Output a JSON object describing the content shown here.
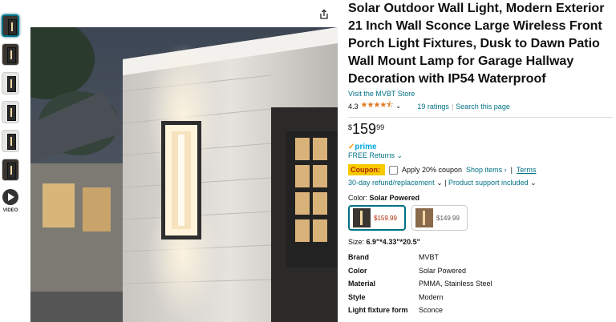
{
  "thumbnails": {
    "video_label": "VIDEO"
  },
  "product": {
    "title": "Solar Outdoor Wall Light, Modern Exterior 21 Inch Wall Sconce Large Wireless Front Porch Light Fixtures, Dusk to Dawn Patio Wall Mount Lamp for Garage Hallway Decoration with IP54 Waterproof",
    "store_link": "Visit the MVBT Store",
    "rating": "4.3",
    "rating_stars": 4.3,
    "ratings_count": "19 ratings",
    "search_page": "Search this page",
    "price_currency": "$",
    "price_whole": "159",
    "price_fraction": "99",
    "prime": "prime",
    "free_returns": "FREE Returns",
    "coupon_badge": "Coupon:",
    "coupon_text": "Apply 20% coupon",
    "shop_items": "Shop items ›",
    "terms": "Terms",
    "refund": "30-day refund/replacement",
    "support": "Product support included",
    "color_label": "Color:",
    "color_value": "Solar Powered",
    "swatches": [
      {
        "price": "$159.99"
      },
      {
        "price": "$149.99"
      }
    ],
    "size_label": "Size:",
    "size_value": "6.9\"*4.33\"*20.5\"",
    "specs": [
      {
        "key": "Brand",
        "value": "MVBT"
      },
      {
        "key": "Color",
        "value": "Solar Powered"
      },
      {
        "key": "Material",
        "value": "PMMA, Stainless Steel"
      },
      {
        "key": "Style",
        "value": "Modern"
      },
      {
        "key": "Light fixture form",
        "value": "Sconce"
      }
    ]
  },
  "colors": {
    "link": "#007185",
    "star": "#de7921",
    "coupon_bg": "#f7ca00",
    "coupon_text": "#b12704",
    "prime": "#00a8e1"
  }
}
